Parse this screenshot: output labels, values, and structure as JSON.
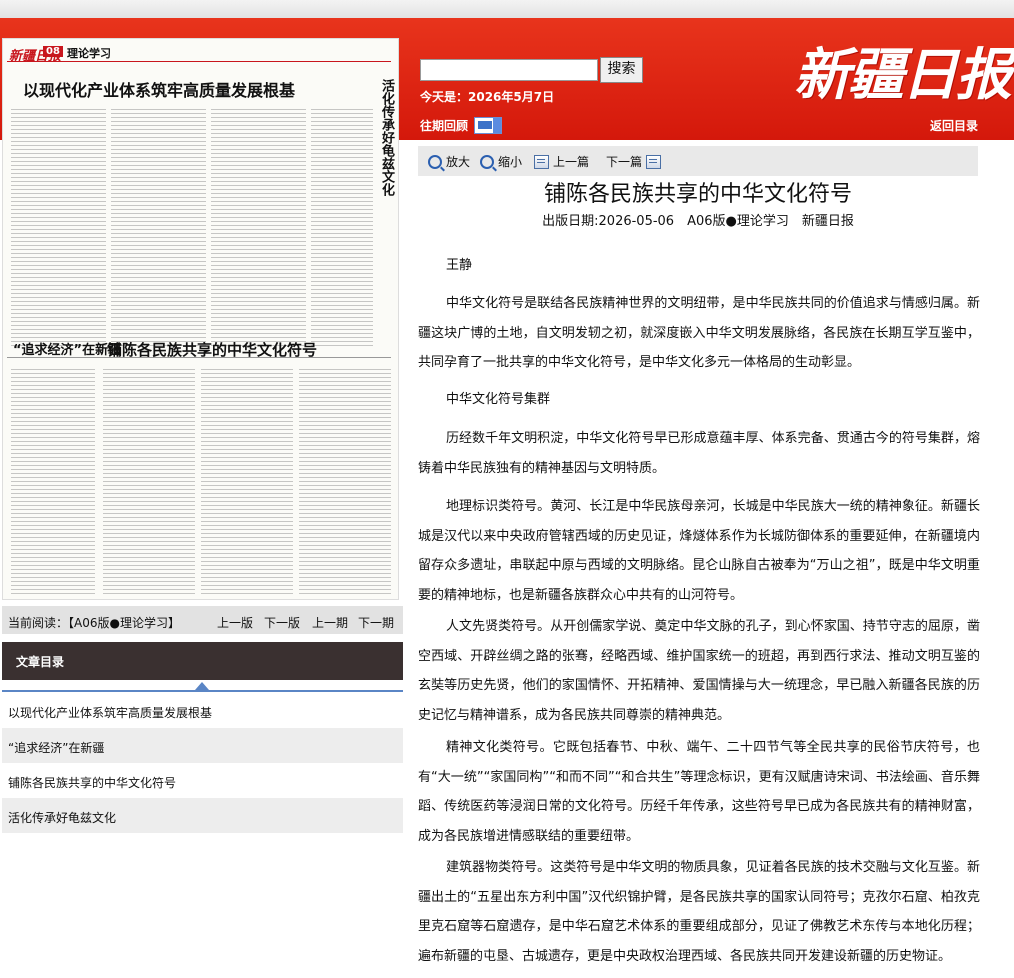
{
  "search": {
    "button_label": "搜索",
    "placeholder": ""
  },
  "header": {
    "today_label": "今天是：2026年5月7日",
    "prev_issue_label": "往期回顾",
    "back_label": "返回目录",
    "logo_text": "新疆日报"
  },
  "paper_thumb": {
    "masthead": "新疆日报",
    "page_no": "08",
    "section": "理论学习",
    "headline_1": "以现代化产业体系筑牢高质量发展根基",
    "headline_2": "铺陈各民族共享的中华文化符号",
    "headline_3": "“追求经济”在新疆",
    "headline_4": "活化传承好龟兹文化"
  },
  "toolbar": {
    "zoom_in": "放大",
    "zoom_out": "缩小",
    "prev_article": "上一篇",
    "next_article": "下一篇"
  },
  "article": {
    "title": "铺陈各民族共享的中华文化符号",
    "meta": "出版日期:2026-05-06　A06版●理论学习　新疆日报",
    "author": "王静",
    "p1": "中华文化符号是联结各民族精神世界的文明纽带，是中华民族共同的价值追求与情感归属。新疆这块广博的土地，自文明发轫之初，就深度嵌入中华文明发展脉络，各民族在长期互学互鉴中，共同孕育了一批共享的中华文化符号，是中华文化多元一体格局的生动彰显。",
    "subhead": "中华文化符号集群",
    "p2": "历经数千年文明积淀，中华文化符号早已形成意蕴丰厚、体系完备、贯通古今的符号集群，熔铸着中华民族独有的精神基因与文明特质。",
    "p3": "地理标识类符号。黄河、长江是中华民族母亲河，长城是中华民族大一统的精神象征。新疆长城是汉代以来中央政府管辖西域的历史见证，烽燧体系作为长城防御体系的重要延伸，在新疆境内留存众多遗址，串联起中原与西域的文明脉络。昆仑山脉自古被奉为“万山之祖”，既是中华文明重要的精神地标，也是新疆各族群众心中共有的山河符号。",
    "p4": "人文先贤类符号。从开创儒家学说、奠定中华文脉的孔子，到心怀家国、持节守志的屈原，凿空西域、开辟丝绸之路的张骞，经略西域、维护国家统一的班超，再到西行求法、推动文明互鉴的玄奘等历史先贤，他们的家国情怀、开拓精神、爱国情操与大一统理念，早已融入新疆各民族的历史记忆与精神谱系，成为各民族共同尊崇的精神典范。",
    "p5": "精神文化类符号。它既包括春节、中秋、端午、二十四节气等全民共享的民俗节庆符号，也有“大一统”“家国同构”“和而不同”“和合共生”等理念标识，更有汉赋唐诗宋词、书法绘画、音乐舞蹈、传统医药等浸润日常的文化符号。历经千年传承，这些符号早已成为各民族共有的精神财富，成为各民族增进情感联结的重要纽带。",
    "p6": "建筑器物类符号。这类符号是中华文明的物质具象，见证着各民族的技术交融与文化互鉴。新疆出土的“五星出东方利中国”汉代织锦护臂，是各民族共享的国家认同符号；克孜尔石窟、柏孜克里克石窟等石窟遗存，是中华石窟艺术体系的重要组成部分，见证了佛教艺术东传与本地化历程；遍布新疆的屯垦、古城遗存，更是中央政权治理西域、各民族共同开发建设新疆的历史物证。"
  },
  "readbar": {
    "current": "当前阅读：【A06版●理论学习】",
    "prev_page": "上一版",
    "next_page": "下一版",
    "prev_issue": "上一期",
    "next_issue": "下一期"
  },
  "toc": {
    "title": "文章目录",
    "items": [
      {
        "label": "以现代化产业体系筑牢高质量发展根基"
      },
      {
        "label": "“追求经济”在新疆"
      },
      {
        "label": "铺陈各民族共享的中华文化符号"
      },
      {
        "label": "活化传承好龟兹文化"
      }
    ]
  }
}
